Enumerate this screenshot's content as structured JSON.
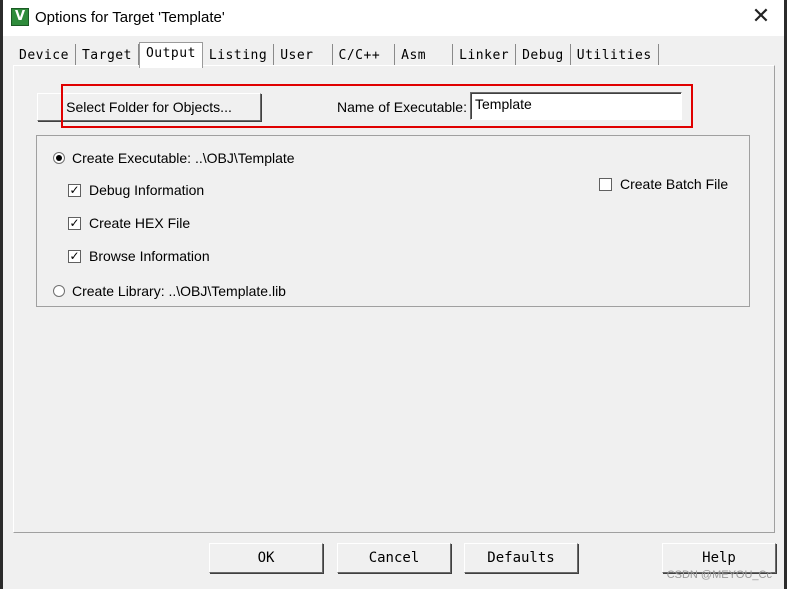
{
  "window": {
    "title": "Options for Target 'Template'",
    "close_glyph": "✕",
    "app_icon_glyph": "V"
  },
  "tabs": [
    {
      "label": "Device",
      "active": false
    },
    {
      "label": "Target",
      "active": false
    },
    {
      "label": "Output",
      "active": true
    },
    {
      "label": "Listing",
      "active": false
    },
    {
      "label": "User",
      "active": false
    },
    {
      "label": "C/C++",
      "active": false
    },
    {
      "label": "Asm",
      "active": false
    },
    {
      "label": "Linker",
      "active": false
    },
    {
      "label": "Debug",
      "active": false
    },
    {
      "label": "Utilities",
      "active": false
    }
  ],
  "output": {
    "select_folder_label": "Select Folder for Objects...",
    "name_label": "Name of Executable:",
    "name_value": "Template",
    "create_executable_label": "Create Executable:  ..\\OBJ\\Template",
    "create_executable_selected": true,
    "debug_info_label": "Debug Information",
    "debug_info_checked": true,
    "create_hex_label": "Create HEX File",
    "create_hex_checked": true,
    "browse_info_label": "Browse Information",
    "browse_info_checked": true,
    "create_library_label": "Create Library:  ..\\OBJ\\Template.lib",
    "create_library_selected": false,
    "create_batch_label": "Create Batch File",
    "create_batch_checked": false
  },
  "buttons": {
    "ok": "OK",
    "cancel": "Cancel",
    "defaults": "Defaults",
    "help": "Help"
  },
  "watermark": "CSDN @MEYOU_Cc",
  "colors": {
    "highlight": "#e00000",
    "dialog_bg": "#f0f0f0"
  }
}
